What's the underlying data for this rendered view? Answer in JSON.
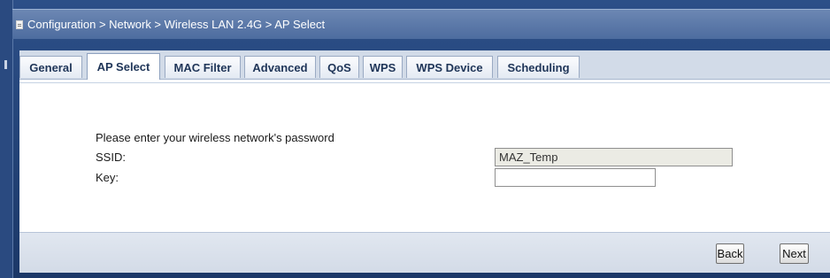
{
  "breadcrumb": "Configuration > Network > Wireless LAN 2.4G > AP Select",
  "tabs": [
    {
      "label": "General",
      "active": false
    },
    {
      "label": "AP Select",
      "active": true
    },
    {
      "label": "MAC Filter",
      "active": false
    },
    {
      "label": "Advanced",
      "active": false
    },
    {
      "label": "QoS",
      "active": false
    },
    {
      "label": "WPS",
      "active": false
    },
    {
      "label": "WPS Device",
      "active": false
    },
    {
      "label": "Scheduling",
      "active": false
    }
  ],
  "form": {
    "prompt": "Please enter your wireless network's password",
    "ssid_label": "SSID:",
    "ssid_value": "MAZ_Temp",
    "key_label": "Key:",
    "key_value": ""
  },
  "footer": {
    "back_label": "Back",
    "next_label": "Next"
  },
  "colors": {
    "frame": "#1f3f73",
    "titlebar": "#5b78a8",
    "tabbar": "#d2dbe8",
    "footer": "#d9e0eb"
  }
}
